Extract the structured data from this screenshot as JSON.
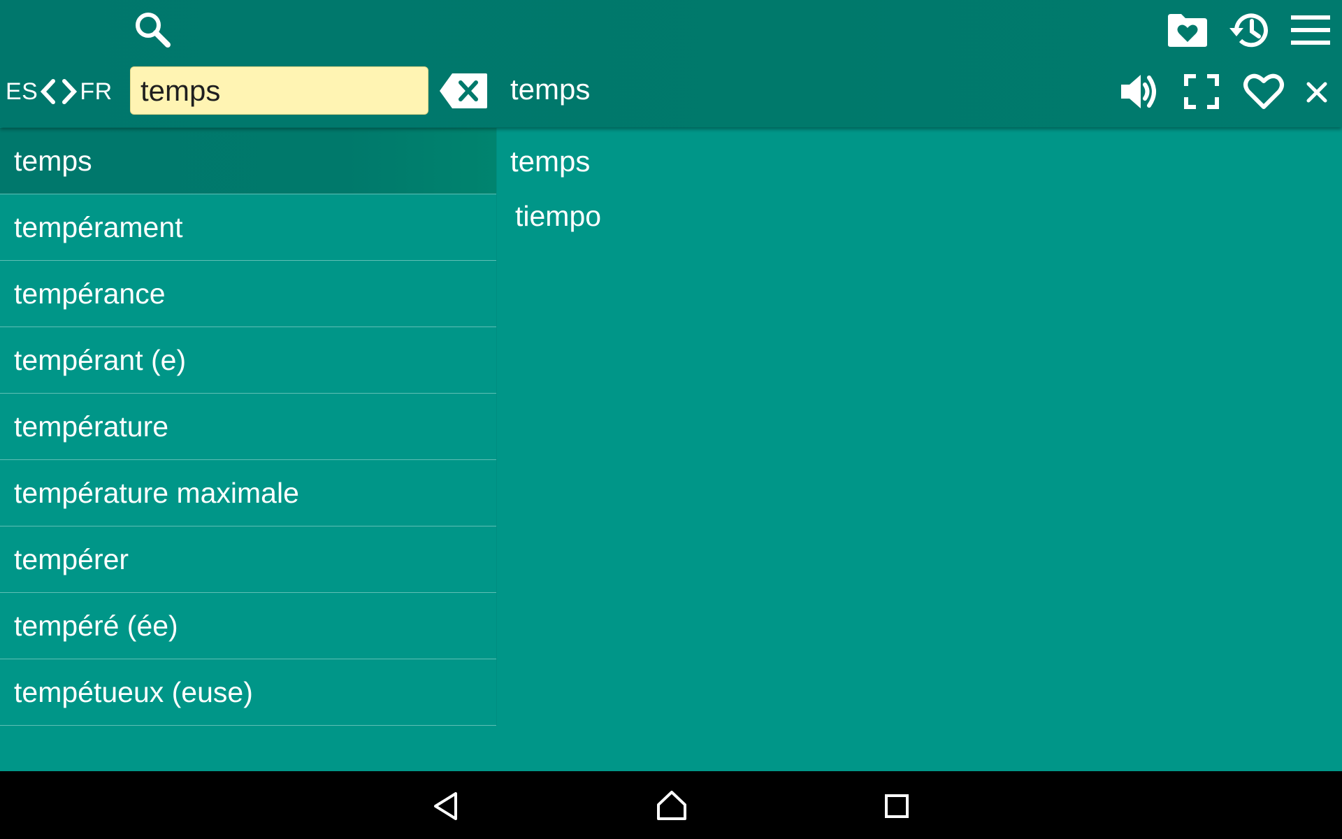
{
  "toolbar": {
    "search_icon": "search-icon",
    "favorites_folder_icon": "folder-heart-icon",
    "history_icon": "history-icon",
    "menu_icon": "menu-icon"
  },
  "language": {
    "source": "ES",
    "target": "FR"
  },
  "search": {
    "value": "temps",
    "placeholder": ""
  },
  "header": {
    "word": "temps",
    "icons": [
      "speaker-icon",
      "fullscreen-icon",
      "heart-icon",
      "close-icon"
    ]
  },
  "word_list": [
    "temps",
    "tempérament",
    "tempérance",
    "tempérant (e)",
    "température",
    "température maximale",
    "tempérer",
    "tempéré (ée)",
    "tempétueux (euse)"
  ],
  "selected_index": 0,
  "detail": {
    "headword": "temps",
    "translation": "tiempo"
  },
  "colors": {
    "primary_dark": "#00796b",
    "background": "#009688",
    "input_background": "#fff4b3",
    "navbar": "#000000"
  },
  "navigation": {
    "icons": [
      "back-icon",
      "home-icon",
      "recents-icon"
    ]
  }
}
